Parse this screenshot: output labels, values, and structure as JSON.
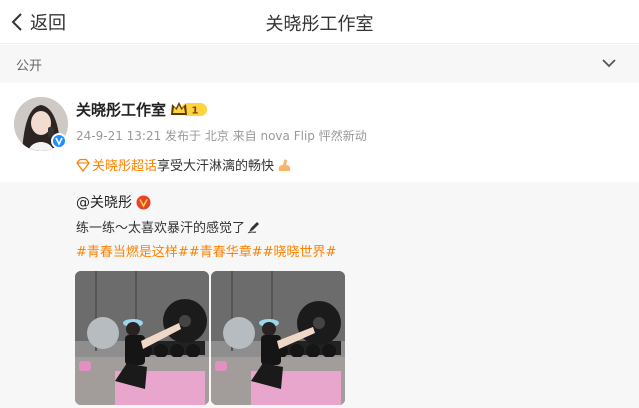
{
  "nav": {
    "back_label": "返回",
    "title": "关晓彤工作室"
  },
  "visibility": {
    "label": "公开"
  },
  "post": {
    "author": "关晓彤工作室",
    "vip_level": "1",
    "meta": "24-9-21 13:21 发布于 北京 来自 nova Flip 怦然新动",
    "topic": "关晓彤超话",
    "status_text": "享受大汗淋漓的畅快"
  },
  "repost": {
    "author": "@关晓彤",
    "text": "练一练～太喜欢暴汗的感觉了",
    "tags": [
      "#青春当燃是这样#",
      "#青春华章#",
      "#晓晓世界#"
    ]
  },
  "colors": {
    "accent": "#ff8200",
    "verify": "#1f8fff",
    "repost_bg": "#f7f7f7"
  }
}
